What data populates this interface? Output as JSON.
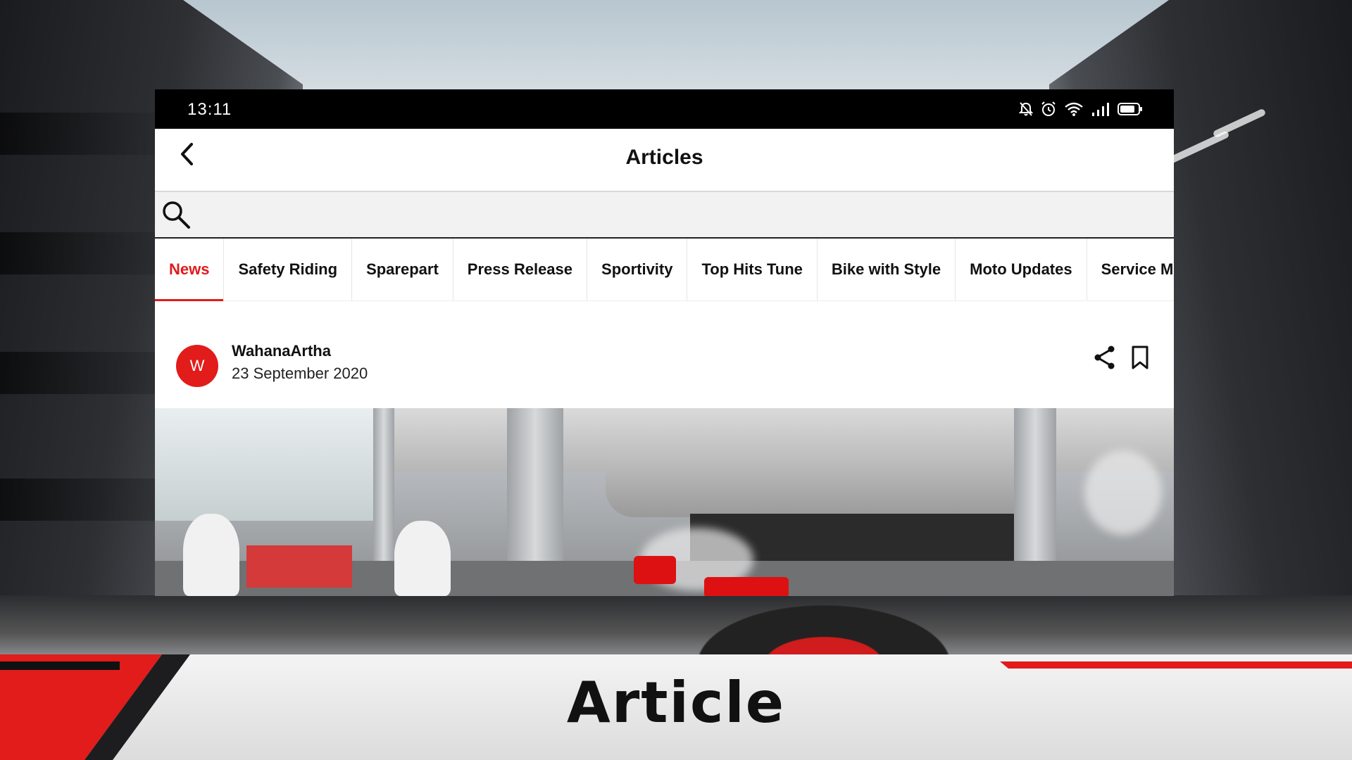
{
  "status_bar": {
    "time": "13:11",
    "icons": [
      "bell-off-icon",
      "alarm-icon",
      "wifi-icon",
      "signal-icon",
      "battery-icon"
    ]
  },
  "app_bar": {
    "title": "Articles",
    "back_icon": "chevron-left-icon"
  },
  "search": {
    "icon": "search-icon",
    "value": "",
    "placeholder": ""
  },
  "tabs": [
    {
      "label": "News",
      "active": true
    },
    {
      "label": "Safety Riding",
      "active": false
    },
    {
      "label": "Sparepart",
      "active": false
    },
    {
      "label": "Press Release",
      "active": false
    },
    {
      "label": "Sportivity",
      "active": false
    },
    {
      "label": "Top Hits Tune",
      "active": false
    },
    {
      "label": "Bike with Style",
      "active": false
    },
    {
      "label": "Moto Updates",
      "active": false
    },
    {
      "label": "Service Motor",
      "active": false
    }
  ],
  "post": {
    "avatar_initial": "W",
    "author": "WahanaArtha",
    "date": "23 September 2020",
    "share_icon": "share-icon",
    "bookmark_icon": "bookmark-icon"
  },
  "caption": "Article",
  "colors": {
    "accent": "#e21b1b",
    "status_bar": "#000000",
    "text": "#111111"
  }
}
